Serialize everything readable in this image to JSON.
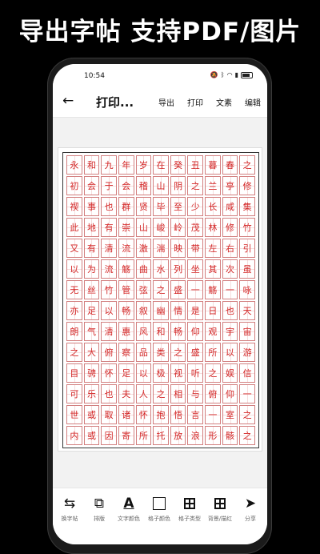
{
  "headline": "导出字帖 支持PDF/图片",
  "status": {
    "time": "10:54",
    "icons": [
      "silent-icon",
      "bluetooth-icon",
      "wifi-icon",
      "sim-icon",
      "battery-icon"
    ]
  },
  "appbar": {
    "title": "打印...",
    "actions": [
      "导出",
      "打印",
      "文素",
      "编辑"
    ]
  },
  "sheet": {
    "rows": [
      [
        "永",
        "和",
        "九",
        "年",
        "岁",
        "在",
        "癸",
        "丑",
        "暮",
        "春",
        "之"
      ],
      [
        "初",
        "会",
        "于",
        "会",
        "稽",
        "山",
        "阴",
        "之",
        "兰",
        "亭",
        "修"
      ],
      [
        "禊",
        "事",
        "也",
        "群",
        "贤",
        "毕",
        "至",
        "少",
        "长",
        "咸",
        "集"
      ],
      [
        "此",
        "地",
        "有",
        "崇",
        "山",
        "峻",
        "岭",
        "茂",
        "林",
        "修",
        "竹"
      ],
      [
        "又",
        "有",
        "清",
        "流",
        "激",
        "湍",
        "映",
        "带",
        "左",
        "右",
        "引"
      ],
      [
        "以",
        "为",
        "流",
        "觞",
        "曲",
        "水",
        "列",
        "坐",
        "其",
        "次",
        "虽"
      ],
      [
        "无",
        "丝",
        "竹",
        "管",
        "弦",
        "之",
        "盛",
        "一",
        "觞",
        "一",
        "咏"
      ],
      [
        "亦",
        "足",
        "以",
        "畅",
        "叙",
        "幽",
        "情",
        "是",
        "日",
        "也",
        "天"
      ],
      [
        "朗",
        "气",
        "清",
        "惠",
        "风",
        "和",
        "畅",
        "仰",
        "观",
        "宇",
        "宙"
      ],
      [
        "之",
        "大",
        "俯",
        "察",
        "品",
        "类",
        "之",
        "盛",
        "所",
        "以",
        "游"
      ],
      [
        "目",
        "骋",
        "怀",
        "足",
        "以",
        "极",
        "视",
        "听",
        "之",
        "娱",
        "信"
      ],
      [
        "可",
        "乐",
        "也",
        "夫",
        "人",
        "之",
        "相",
        "与",
        "俯",
        "仰",
        "一"
      ],
      [
        "世",
        "或",
        "取",
        "诸",
        "怀",
        "抱",
        "悟",
        "言",
        "一",
        "室",
        "之"
      ],
      [
        "内",
        "或",
        "因",
        "寄",
        "所",
        "托",
        "放",
        "浪",
        "形",
        "骸",
        "之"
      ]
    ]
  },
  "toolbar": [
    {
      "label": "换字帖",
      "icon": "swap-icon"
    },
    {
      "label": "排版",
      "icon": "layout-icon"
    },
    {
      "label": "文字颜色",
      "icon": "text-color-icon"
    },
    {
      "label": "格子颜色",
      "icon": "square-icon"
    },
    {
      "label": "格子类型",
      "icon": "grid-icon"
    },
    {
      "label": "背景/描红",
      "icon": "grid-filled-icon"
    },
    {
      "label": "分享",
      "icon": "send-icon"
    }
  ],
  "colors": {
    "accent": "#d21f1f",
    "grid": "#d27f7f"
  }
}
